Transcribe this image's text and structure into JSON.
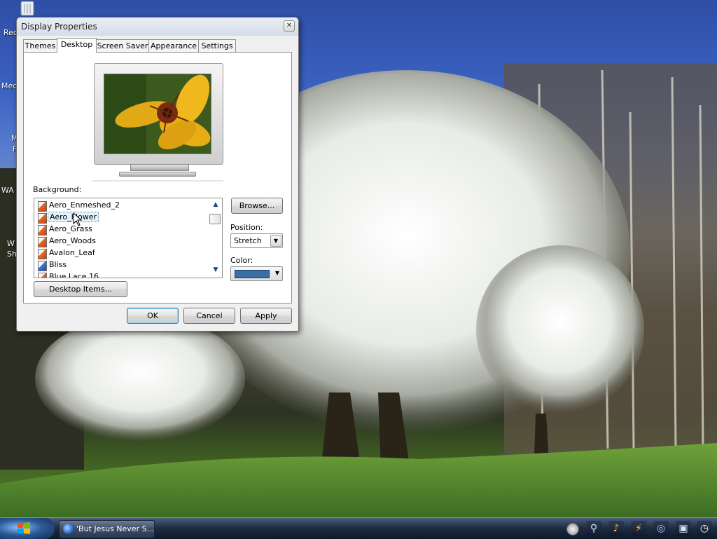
{
  "desktop": {
    "icon_labels": [
      "Rec",
      "Med",
      "M",
      "F",
      "WA",
      "W",
      "Sh"
    ]
  },
  "dialog": {
    "title": "Display Properties",
    "tabs": [
      {
        "label": "Themes"
      },
      {
        "label": "Desktop"
      },
      {
        "label": "Screen Saver"
      },
      {
        "label": "Appearance"
      },
      {
        "label": "Settings"
      }
    ],
    "active_tab": "Desktop",
    "background_label": "Background:",
    "background_items": [
      {
        "label": "Aero_Enmeshed_2"
      },
      {
        "label": "Aero_Flower"
      },
      {
        "label": "Aero_Grass"
      },
      {
        "label": "Aero_Woods"
      },
      {
        "label": "Avalon_Leaf"
      },
      {
        "label": "Bliss"
      },
      {
        "label": "Blue Lace 16"
      }
    ],
    "selected_background": "Aero_Flower",
    "browse_label": "Browse...",
    "position_label": "Position:",
    "position_value": "Stretch",
    "color_label": "Color:",
    "color_value": "#3a6ea5",
    "desktop_items_label": "Desktop Items...",
    "ok_label": "OK",
    "cancel_label": "Cancel",
    "apply_label": "Apply",
    "close_glyph": "✕"
  },
  "taskbar": {
    "task_label": "'But Jesus Never S...",
    "tray_icons": [
      "magnifier-icon",
      "bell-icon",
      "lightning-icon",
      "network-icon",
      "monitor-icon",
      "clock-icon"
    ]
  }
}
